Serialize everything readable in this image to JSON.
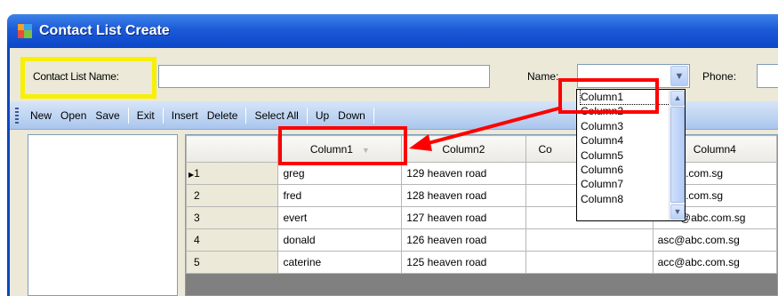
{
  "window": {
    "title": "Contact List Create"
  },
  "form": {
    "contact_list_name_label": "Contact List Name:",
    "contact_list_name_value": "",
    "name_label": "Name:",
    "phone_label": "Phone:"
  },
  "toolbar": {
    "buttons": [
      "New",
      "Open",
      "Save",
      "Exit",
      "Insert",
      "Delete",
      "Select All",
      "Up",
      "Down"
    ]
  },
  "grid": {
    "columns": [
      "Column1",
      "Column2",
      "Co",
      "Column4"
    ],
    "rows": [
      {
        "num": "1",
        "c1": "greg",
        "c2": "129 heaven road",
        "c3": "",
        "c4": "@abc.com.sg",
        "current": true
      },
      {
        "num": "2",
        "c1": "fred",
        "c2": "128 heaven road",
        "c3": "",
        "c4": "@abc.com.sg"
      },
      {
        "num": "3",
        "c1": "evert",
        "c2": "127 heaven road",
        "c3": "",
        "c4": "abvc@abc.com.sg"
      },
      {
        "num": "4",
        "c1": "donald",
        "c2": "126 heaven road",
        "c3": "",
        "c4": "asc@abc.com.sg"
      },
      {
        "num": "5",
        "c1": "caterine",
        "c2": "125 heaven road",
        "c3": "",
        "c4": "acc@abc.com.sg"
      }
    ]
  },
  "name_dropdown": {
    "options": [
      "Column1",
      "Column2",
      "Column3",
      "Column4",
      "Column5",
      "Column6",
      "Column7",
      "Column8"
    ],
    "selected": "Column1"
  },
  "colors": {
    "title_bar": "#1c5ad8",
    "highlight_yellow": "#f7f000",
    "annotation_red": "#ff0000"
  },
  "icons": {
    "app": "app-icon",
    "combo": "chevron-down-icon",
    "scroll_up": "chevron-up-icon",
    "scroll_down": "chevron-down-icon",
    "current_row": "row-pointer-icon"
  }
}
